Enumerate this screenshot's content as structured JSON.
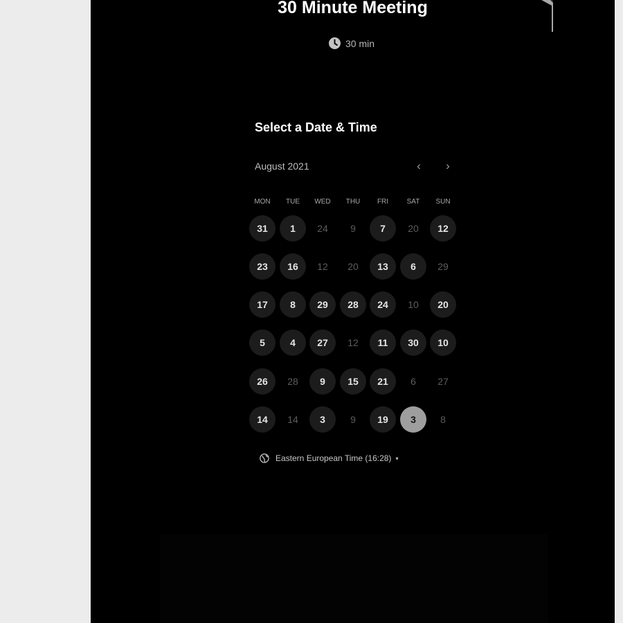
{
  "event": {
    "title": "30 Minute Meeting",
    "duration": "30 min"
  },
  "calendar": {
    "heading": "Select a Date & Time",
    "month": "August 2021",
    "prev_glyph": "‹",
    "next_glyph": "›",
    "weekdays": [
      "MON",
      "TUE",
      "WED",
      "THU",
      "FRI",
      "SAT",
      "SUN"
    ],
    "weeks": [
      [
        {
          "d": "31",
          "s": "available"
        },
        {
          "d": "1",
          "s": "available"
        },
        {
          "d": "24",
          "s": "unavailable"
        },
        {
          "d": "9",
          "s": "unavailable"
        },
        {
          "d": "7",
          "s": "available"
        },
        {
          "d": "20",
          "s": "unavailable"
        },
        {
          "d": "12",
          "s": "available"
        }
      ],
      [
        {
          "d": "23",
          "s": "available"
        },
        {
          "d": "16",
          "s": "available"
        },
        {
          "d": "12",
          "s": "unavailable"
        },
        {
          "d": "20",
          "s": "unavailable"
        },
        {
          "d": "13",
          "s": "available"
        },
        {
          "d": "6",
          "s": "available"
        },
        {
          "d": "29",
          "s": "unavailable"
        }
      ],
      [
        {
          "d": "17",
          "s": "available"
        },
        {
          "d": "8",
          "s": "available"
        },
        {
          "d": "29",
          "s": "available"
        },
        {
          "d": "28",
          "s": "available"
        },
        {
          "d": "24",
          "s": "available"
        },
        {
          "d": "10",
          "s": "unavailable"
        },
        {
          "d": "20",
          "s": "available"
        }
      ],
      [
        {
          "d": "5",
          "s": "available"
        },
        {
          "d": "4",
          "s": "available"
        },
        {
          "d": "27",
          "s": "available"
        },
        {
          "d": "12",
          "s": "unavailable"
        },
        {
          "d": "11",
          "s": "available"
        },
        {
          "d": "30",
          "s": "available"
        },
        {
          "d": "10",
          "s": "available"
        }
      ],
      [
        {
          "d": "26",
          "s": "available"
        },
        {
          "d": "28",
          "s": "unavailable"
        },
        {
          "d": "9",
          "s": "available"
        },
        {
          "d": "15",
          "s": "available"
        },
        {
          "d": "21",
          "s": "available"
        },
        {
          "d": "6",
          "s": "unavailable"
        },
        {
          "d": "27",
          "s": "unavailable"
        }
      ],
      [
        {
          "d": "14",
          "s": "available"
        },
        {
          "d": "14",
          "s": "unavailable"
        },
        {
          "d": "3",
          "s": "available"
        },
        {
          "d": "9",
          "s": "unavailable"
        },
        {
          "d": "19",
          "s": "available"
        },
        {
          "d": "3",
          "s": "selected"
        },
        {
          "d": "8",
          "s": "unavailable"
        }
      ]
    ]
  },
  "timezone": {
    "label": "Eastern European Time (16:28)",
    "caret": "▾"
  },
  "colors": {
    "background": "#000000",
    "page": "#ececec",
    "available_day": "#1c1c1c",
    "selected_day": "#9e9e9e",
    "ribbon": "#a8a8a8"
  },
  "icons": [
    "clock-icon",
    "globe-icon",
    "chevron-left-icon",
    "chevron-right-icon",
    "caret-down-icon"
  ]
}
